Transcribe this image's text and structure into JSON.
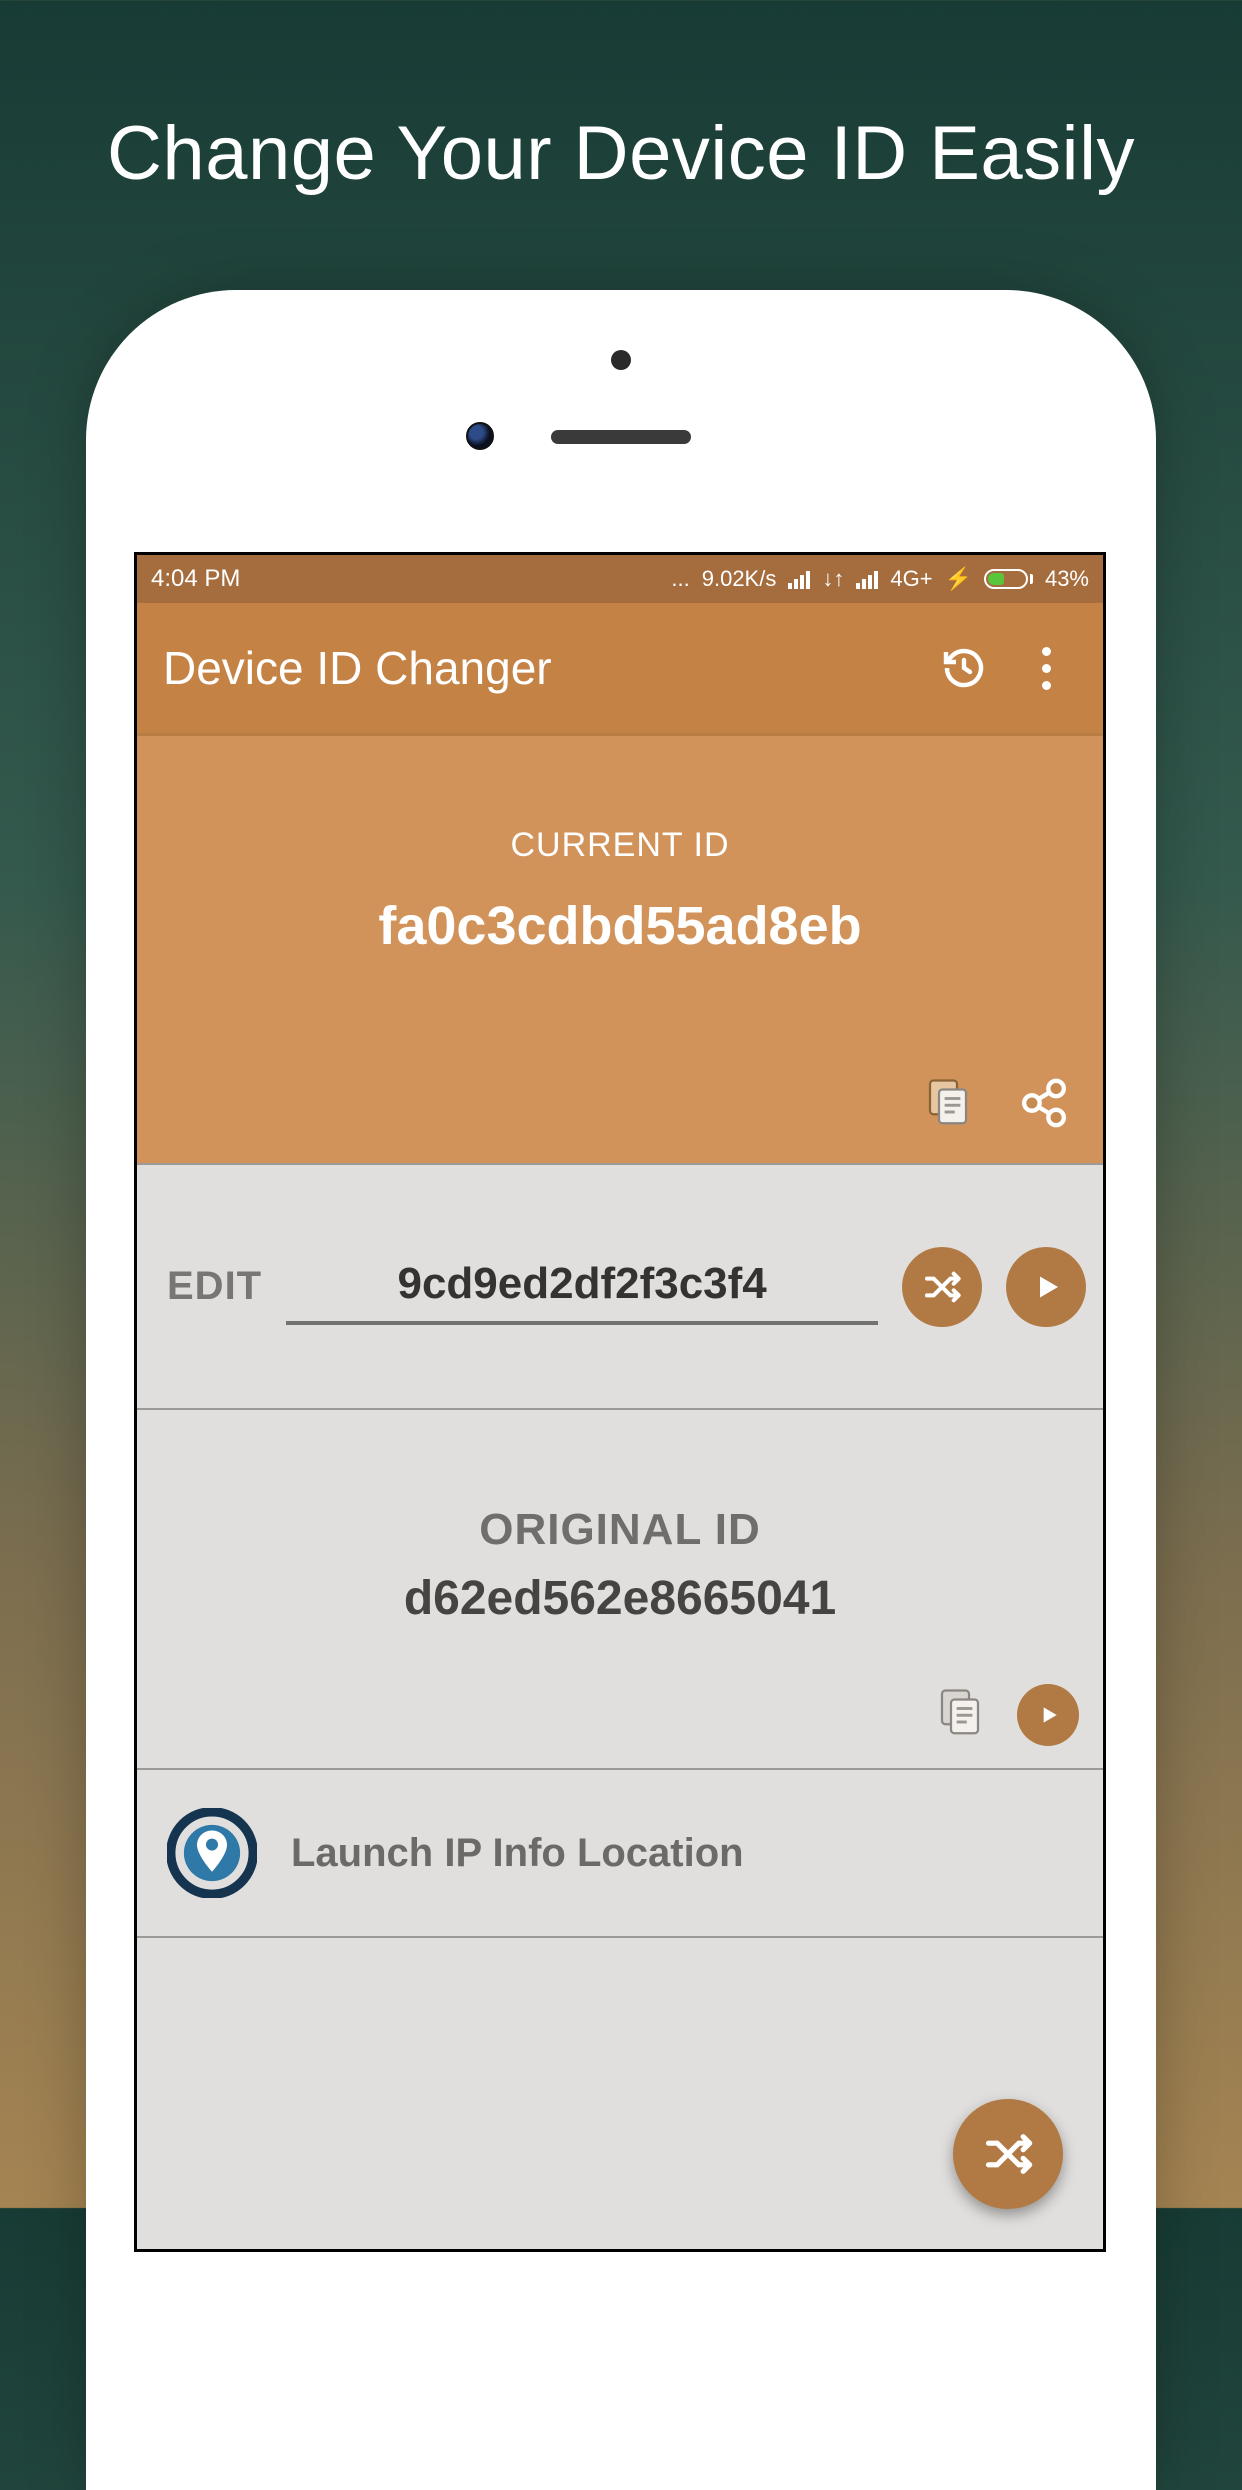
{
  "promo": {
    "title": "Change Your Device ID Easily"
  },
  "statusbar": {
    "time": "4:04 PM",
    "speed": "9.02K/s",
    "network": "4G+",
    "battery_pct": "43%"
  },
  "appbar": {
    "title": "Device ID Changer"
  },
  "current": {
    "label": "CURRENT ID",
    "value": "fa0c3cdbd55ad8eb"
  },
  "edit": {
    "label": "EDIT",
    "value": "9cd9ed2df2f3c3f4"
  },
  "original": {
    "label": "ORIGINAL ID",
    "value": "d62ed562e8665041"
  },
  "ipinfo": {
    "label": "Launch IP Info Location"
  }
}
